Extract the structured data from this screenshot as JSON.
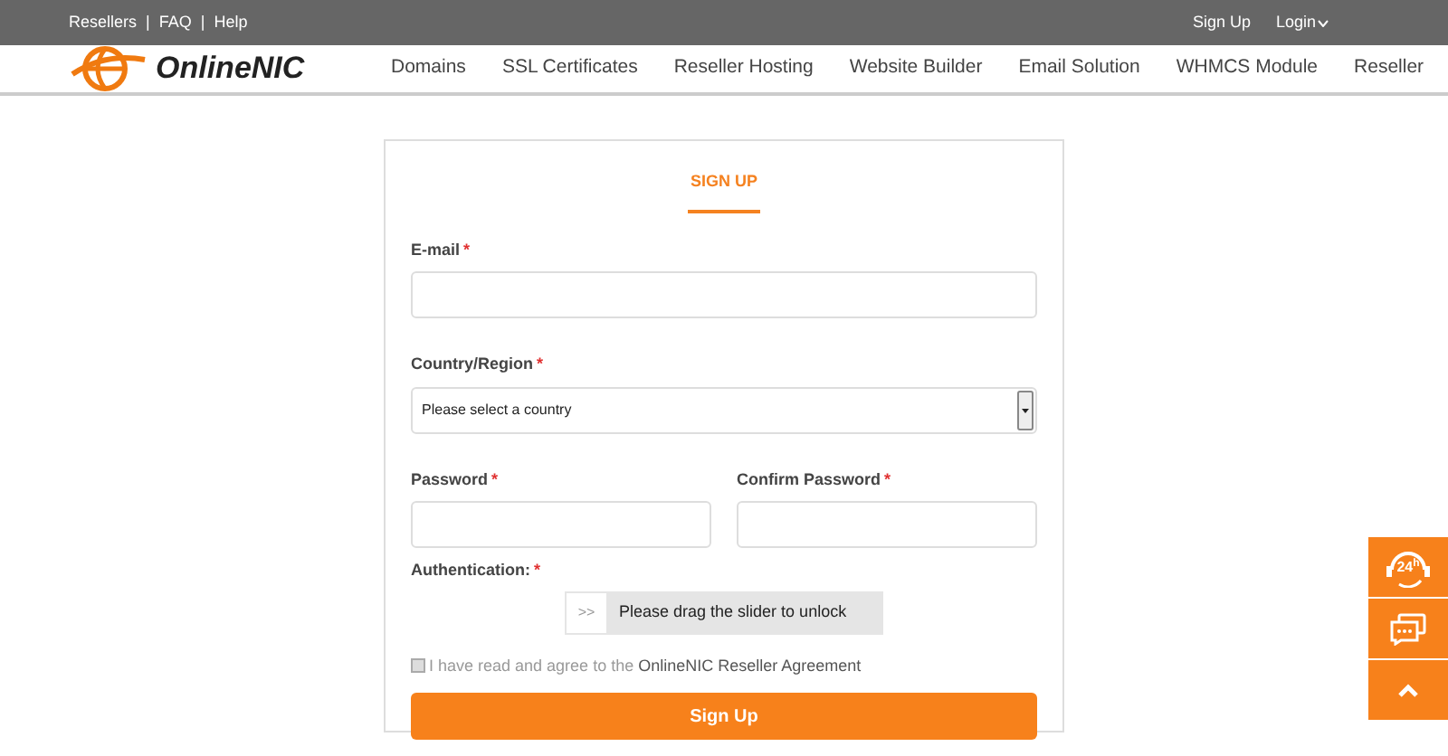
{
  "top_bar": {
    "left_links": [
      "Resellers",
      "FAQ",
      "Help"
    ],
    "separator": "|",
    "right_links": [
      {
        "label": "Sign Up",
        "dropdown": false
      },
      {
        "label": "Login",
        "dropdown": true
      }
    ]
  },
  "header": {
    "logo_text": "OnlineNIC",
    "nav": [
      "Domains",
      "SSL Certificates",
      "Reseller Hosting",
      "Website Builder",
      "Email Solution",
      "WHMCS Module",
      "Reseller"
    ]
  },
  "form": {
    "title": "SIGN UP",
    "email": {
      "label": "E-mail",
      "required": "*"
    },
    "country": {
      "label": "Country/Region",
      "required": "*",
      "value": "Please select a country"
    },
    "password": {
      "label": "Password",
      "required": "*"
    },
    "confirm_password": {
      "label": "Confirm Password",
      "required": "*"
    },
    "authentication": {
      "label": "Authentication:",
      "required": "*",
      "handle": ">>",
      "level": 0,
      "slider_text": "Please drag the slider to unlock"
    },
    "agreement": {
      "checked": false,
      "text": "I have read and agree to the",
      "link": "OnlineNIC Reseller Agreement"
    },
    "submit": "Sign Up"
  },
  "side_buttons": [
    {
      "kind": "support",
      "text": "24$^{h}$"
    },
    {
      "kind": "chat"
    },
    {
      "kind": "top"
    }
  ]
}
